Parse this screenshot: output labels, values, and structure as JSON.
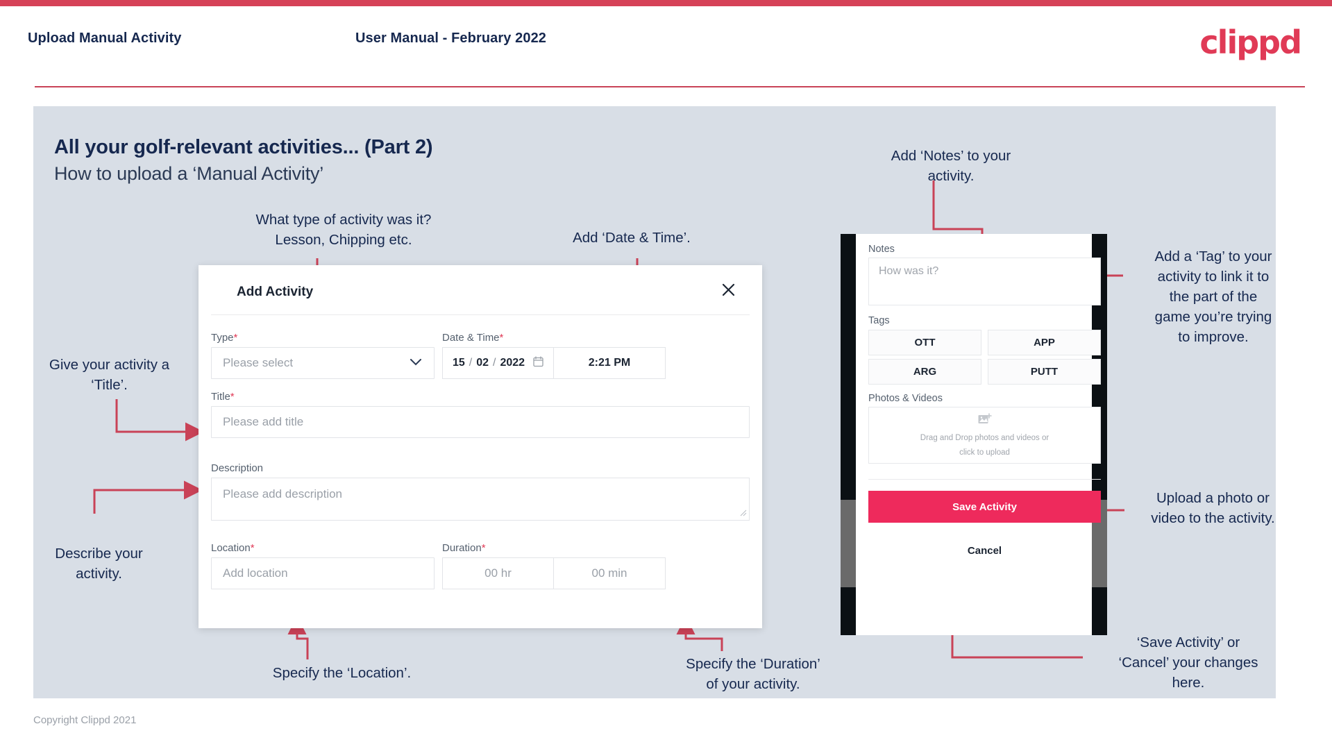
{
  "header": {
    "left_title": "Upload Manual Activity",
    "center_title": "User Manual - February 2022",
    "logo": "clippd"
  },
  "slide": {
    "title": "All your golf-relevant activities... (Part 2)",
    "subtitle": "How to upload a ‘Manual Activity’"
  },
  "annotations": {
    "type": "What type of activity was it?\nLesson, Chipping etc.",
    "datetime": "Add ‘Date & Time’.",
    "title": "Give your activity a\n‘Title’.",
    "description": "Describe your\nactivity.",
    "location": "Specify the ‘Location’.",
    "duration": "Specify the ‘Duration’\nof your activity.",
    "notes": "Add ‘Notes’ to your\nactivity.",
    "tags": "Add a ‘Tag’ to your\nactivity to link it to\nthe part of the\ngame you’re trying\nto improve.",
    "photos": "Upload a photo or\nvideo to the activity.",
    "save_cancel": "‘Save Activity’ or\n‘Cancel’ your changes\nhere."
  },
  "modal": {
    "title": "Add Activity",
    "close_icon": "close-icon",
    "fields": {
      "type": {
        "label": "Type",
        "required": "*",
        "placeholder": "Please select",
        "icon": "chevron-down-icon"
      },
      "datetime": {
        "label": "Date & Time",
        "required": "*",
        "day": "15",
        "month": "02",
        "year": "2022",
        "sep": "/",
        "calendar_icon": "calendar-icon",
        "time": "2:21 PM"
      },
      "title": {
        "label": "Title",
        "required": "*",
        "placeholder": "Please add title"
      },
      "description": {
        "label": "Description",
        "required": "",
        "placeholder": "Please add description"
      },
      "location": {
        "label": "Location",
        "required": "*",
        "placeholder": "Add location"
      },
      "duration": {
        "label": "Duration",
        "required": "*",
        "hours_placeholder": "00 hr",
        "minutes_placeholder": "00 min"
      }
    }
  },
  "phone": {
    "notes_label": "Notes",
    "notes_placeholder": "How was it?",
    "tags_label": "Tags",
    "tags": [
      "OTT",
      "APP",
      "ARG",
      "PUTT"
    ],
    "photos_label": "Photos & Videos",
    "dropzone_icon": "add-image-icon",
    "dropzone_line1": "Drag and Drop photos and videos or",
    "dropzone_line2": "click to upload",
    "save_label": "Save Activity",
    "cancel_label": "Cancel"
  },
  "footer": {
    "copyright": "Copyright Clippd 2021"
  },
  "colors": {
    "accent": "#D64258",
    "brand_pink": "#EE2A5C",
    "slide_bg": "#D8DEE6",
    "navy_text": "#16284F",
    "arrow": "#C94257"
  }
}
